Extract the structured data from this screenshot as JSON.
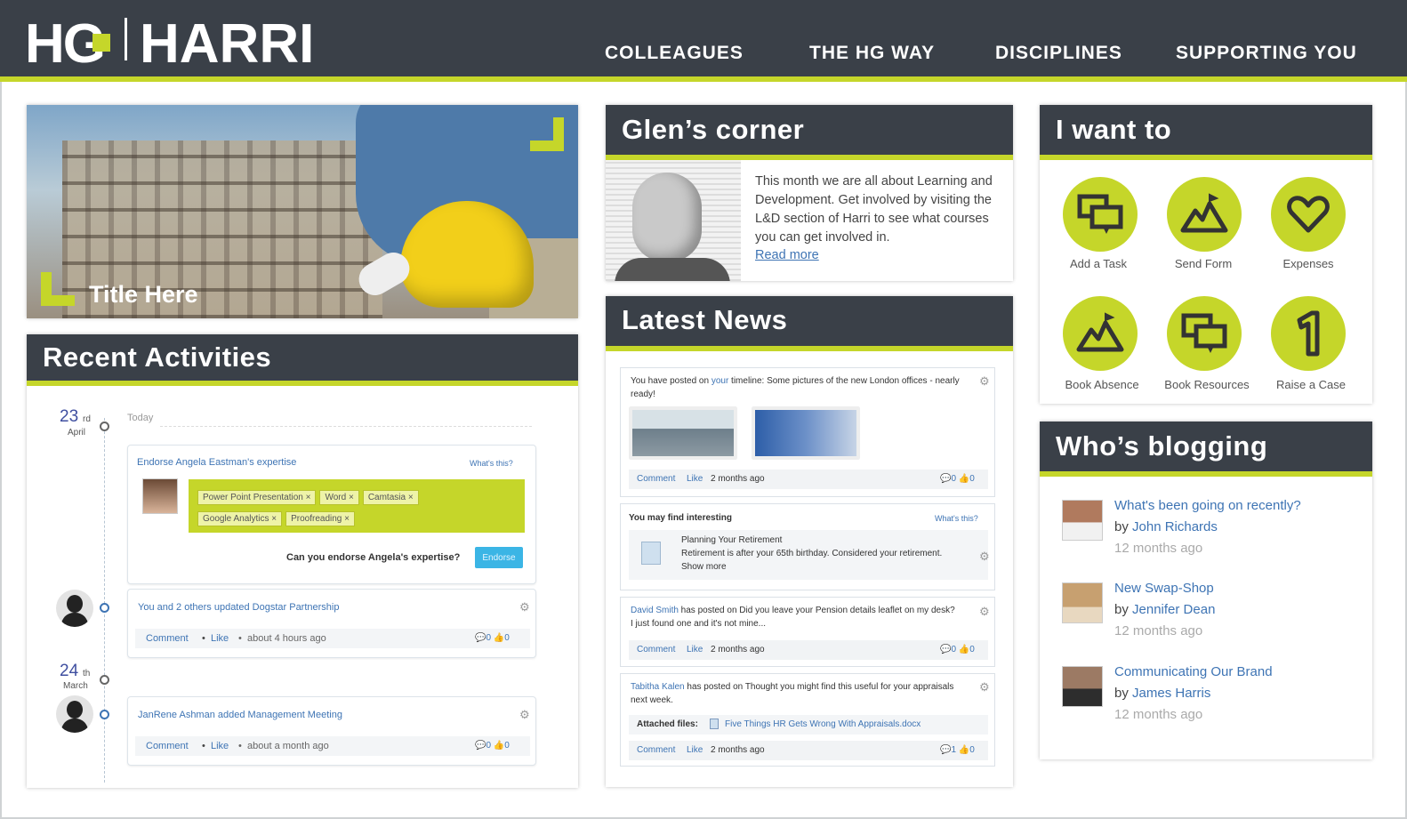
{
  "header": {
    "logo_hg": "HG",
    "logo_name": "HARRI",
    "nav": [
      "COLLEAGUES",
      "THE HG WAY",
      "DISCIPLINES",
      "SUPPORTING YOU"
    ]
  },
  "hero": {
    "title": "Title Here"
  },
  "recent": {
    "title": "Recent Activities",
    "date1": {
      "day": "23",
      "suffix": "rd",
      "month": "April",
      "label": "Today"
    },
    "endorse": {
      "heading": "Endorse Angela Eastman's expertise",
      "whats_this": "What's this?",
      "tags": [
        "Power Point Presentation ×",
        "Word ×",
        "Camtasia ×",
        "Google Analytics ×",
        "Proofreading ×"
      ],
      "question": "Can you endorse Angela's expertise?",
      "button": "Endorse"
    },
    "activity1": {
      "you": "You and ",
      "others": "2 others",
      "updated": " updated ",
      "target": "Dogstar Partnership",
      "comment": "Comment",
      "like": "Like",
      "time": "about 4 hours ago",
      "counts": "💬0  👍0"
    },
    "date2": {
      "day": "24",
      "suffix": "th",
      "month": "March"
    },
    "activity2": {
      "who": "JanRene Ashman",
      "added": " added ",
      "target": "Management Meeting",
      "comment": "Comment",
      "like": "Like",
      "time": "about a month ago",
      "counts": "💬0  👍0"
    }
  },
  "glens": {
    "title": "Glen’s corner",
    "body": "This month we are all about Learning and Development. Get involved by visiting the L&D section of Harri to see what courses you can get involved in.",
    "read_more": "Read more"
  },
  "news": {
    "title": "Latest News",
    "item1": {
      "pre": "You have posted on ",
      "your": "your",
      "post": " timeline: Some pictures of the new London offices - nearly ready!",
      "comment": "Comment",
      "like": "Like",
      "time": "2 months ago",
      "counts": "💬0  👍0"
    },
    "item2": {
      "heading": "You may find interesting",
      "whats_this": "What's this?",
      "link": "Planning Your Retirement",
      "text": "Retirement is after your 65th birthday. Considered your retirement.",
      "show_more": "Show more"
    },
    "item3": {
      "who": "David Smith",
      "text": " has posted on Did you leave your Pension details leaflet on my desk? I just found one and it's not mine...",
      "comment": "Comment",
      "like": "Like",
      "time": "2 months ago",
      "counts": "💬0  👍0"
    },
    "item4": {
      "who": "Tabitha Kalen",
      "text": " has posted on Thought you might find this useful for your appraisals next week.",
      "attached_label": "Attached files:",
      "file": "Five Things HR Gets Wrong With Appraisals.docx",
      "comment": "Comment",
      "like": "Like",
      "time": "2 months ago",
      "counts": "💬1  👍0"
    }
  },
  "iwant": {
    "title": "I want to",
    "items": [
      {
        "label": "Add a Task",
        "icon": "chat-bubbles-icon"
      },
      {
        "label": "Send Form",
        "icon": "mountain-flag-icon"
      },
      {
        "label": "Expenses",
        "icon": "heart-icon"
      },
      {
        "label": "Book Absence",
        "icon": "mountain-flag-icon"
      },
      {
        "label": "Book Resources",
        "icon": "chat-bubbles-icon"
      },
      {
        "label": "Raise a Case",
        "icon": "number-one-icon"
      }
    ]
  },
  "blogging": {
    "title": "Who’s blogging",
    "posts": [
      {
        "title": "What's been going on recently?",
        "by": "by ",
        "author": "John Richards",
        "time": "12 months ago"
      },
      {
        "title": "New Swap-Shop",
        "by": "by ",
        "author": "Jennifer Dean",
        "time": "12 months ago"
      },
      {
        "title": "Communicating Our Brand",
        "by": "by ",
        "author": "James Harris",
        "time": "12 months ago"
      }
    ]
  },
  "colors": {
    "header": "#3a4048",
    "accent": "#c5d62a",
    "link": "#3e74b4"
  }
}
